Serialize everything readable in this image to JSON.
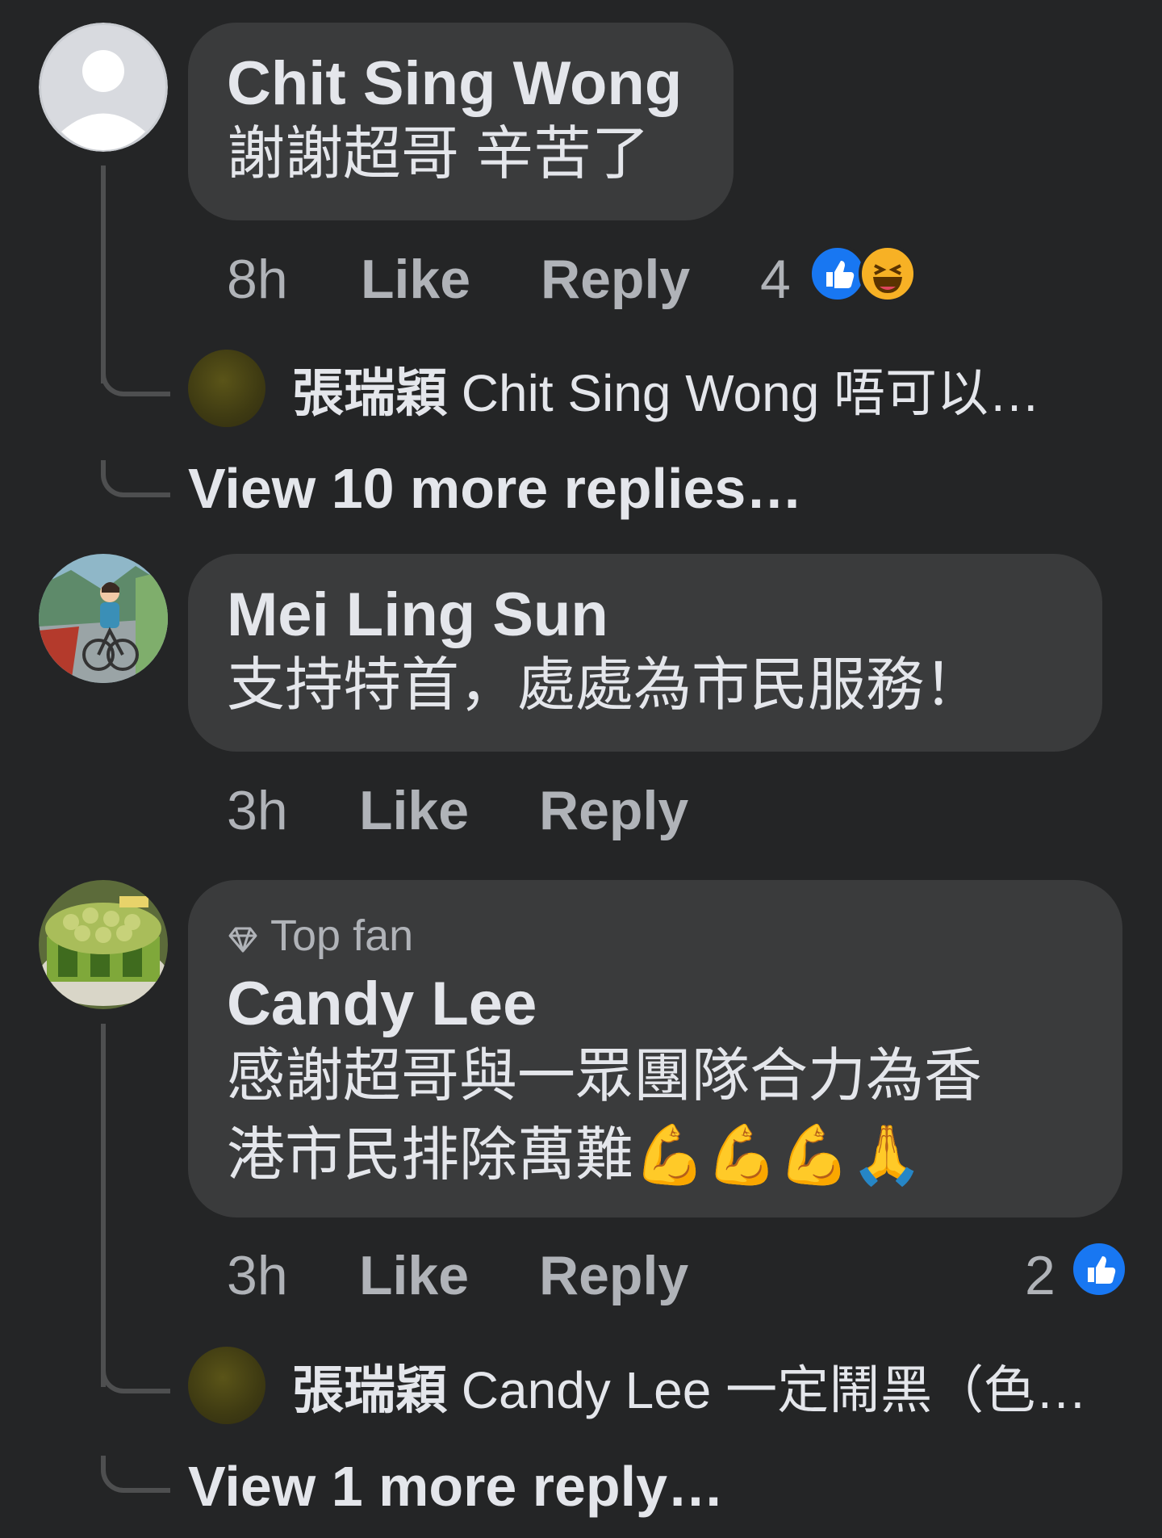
{
  "comments": [
    {
      "author": "Chit Sing Wong",
      "text_lines": [
        "謝謝超哥 辛苦了"
      ],
      "time": "8h",
      "like_label": "Like",
      "reply_label": "Reply",
      "reaction_count": "4",
      "reactions": [
        "like-icon",
        "haha-icon"
      ],
      "reply_preview": {
        "author": "張瑞穎",
        "text": "Chit Sing Wong 唔可以…"
      },
      "view_more": "View 10 more replies…"
    },
    {
      "author": "Mei Ling Sun",
      "text_lines": [
        "支持特首，處處為市民服務！"
      ],
      "time": "3h",
      "like_label": "Like",
      "reply_label": "Reply"
    },
    {
      "badge": "Top fan",
      "author": "Candy Lee",
      "text_lines": [
        "感謝超哥與一眾團隊合力為香",
        "港市民排除萬難💪💪💪🙏"
      ],
      "time": "3h",
      "like_label": "Like",
      "reply_label": "Reply",
      "reaction_count": "2",
      "reactions": [
        "like-icon"
      ],
      "reply_preview": {
        "author": "張瑞穎",
        "text": "Candy Lee 一定鬧黑（色…"
      },
      "view_more": "View 1 more reply…"
    }
  ],
  "colors": {
    "background": "#242526",
    "bubble": "#3a3b3c",
    "primary_text": "#e4e6eb",
    "secondary_text": "#b0b3b8",
    "like_blue": "#1877f2",
    "haha_yellow": "#f7b125"
  }
}
